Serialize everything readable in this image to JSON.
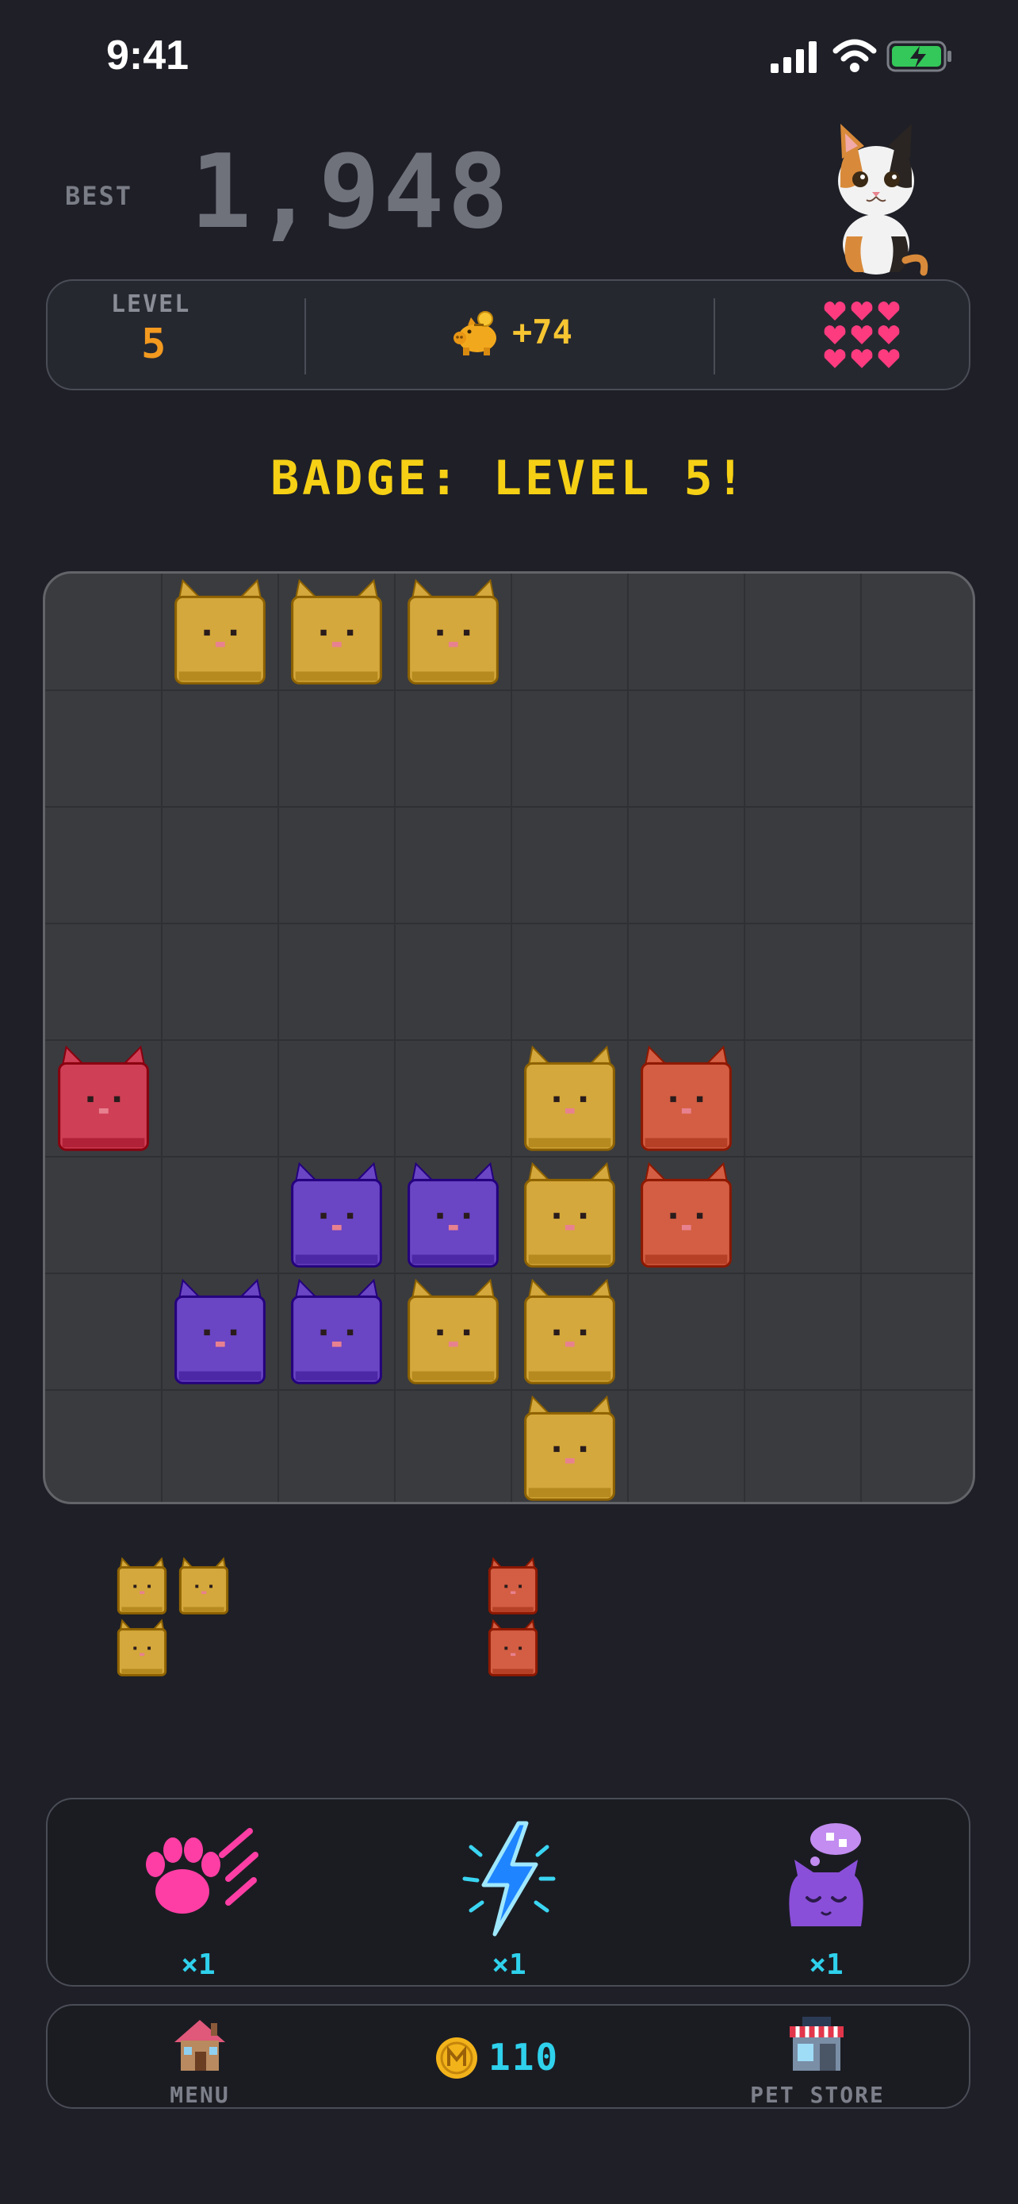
{
  "status": {
    "time": "9:41"
  },
  "header": {
    "best_label": "BEST",
    "best_score": "1,948"
  },
  "stats": {
    "level_label": "LEVEL",
    "level_value": "5",
    "coins_gain": "+74",
    "lives": 9
  },
  "badge_text": "BADGE: LEVEL 5!",
  "board": {
    "cols": 8,
    "rows": 8,
    "colors": {
      "yellow": "#d4a83c",
      "red": "#cf3f55",
      "orange": "#d35e43",
      "purple": "#6a45c4"
    },
    "cells": [
      {
        "row": 0,
        "col": 1,
        "color": "yellow"
      },
      {
        "row": 0,
        "col": 2,
        "color": "yellow"
      },
      {
        "row": 0,
        "col": 3,
        "color": "yellow"
      },
      {
        "row": 4,
        "col": 0,
        "color": "red"
      },
      {
        "row": 4,
        "col": 4,
        "color": "yellow"
      },
      {
        "row": 4,
        "col": 5,
        "color": "orange"
      },
      {
        "row": 5,
        "col": 2,
        "color": "purple"
      },
      {
        "row": 5,
        "col": 3,
        "color": "purple"
      },
      {
        "row": 5,
        "col": 4,
        "color": "yellow"
      },
      {
        "row": 5,
        "col": 5,
        "color": "orange"
      },
      {
        "row": 6,
        "col": 1,
        "color": "purple"
      },
      {
        "row": 6,
        "col": 2,
        "color": "purple"
      },
      {
        "row": 6,
        "col": 3,
        "color": "yellow"
      },
      {
        "row": 6,
        "col": 4,
        "color": "yellow"
      },
      {
        "row": 7,
        "col": 4,
        "color": "yellow"
      }
    ]
  },
  "next_pieces": [
    {
      "color": "yellow",
      "cells": [
        [
          0,
          0
        ],
        [
          0,
          1
        ],
        [
          1,
          0
        ]
      ]
    },
    {
      "color": "orange",
      "cells": [
        [
          0,
          0
        ],
        [
          1,
          0
        ]
      ]
    }
  ],
  "powerups": [
    {
      "icon": "paw-claw-icon",
      "count": "×1"
    },
    {
      "icon": "lightning-icon",
      "count": "×1"
    },
    {
      "icon": "sleeping-cat-icon",
      "count": "×1"
    }
  ],
  "nav": {
    "menu_label": "MENU",
    "coins": "110",
    "store_label": "PET STORE"
  }
}
